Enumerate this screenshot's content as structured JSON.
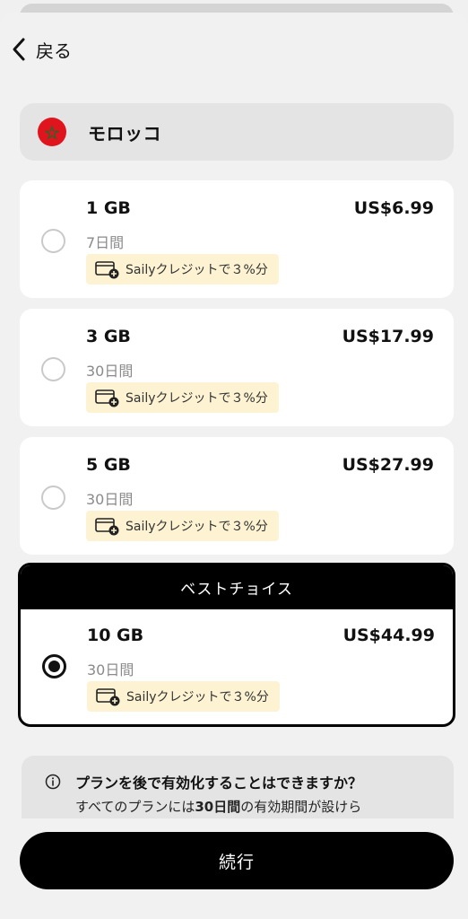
{
  "header": {
    "back_label": "戻る"
  },
  "country": {
    "name": "モロッコ",
    "flag_color": "#e0141c"
  },
  "plans": [
    {
      "size": "1 GB",
      "price": "US$6.99",
      "duration": "7日間",
      "credit": "Sailyクレジットで３%分",
      "selected": false
    },
    {
      "size": "3 GB",
      "price": "US$17.99",
      "duration": "30日間",
      "credit": "Sailyクレジットで３%分",
      "selected": false
    },
    {
      "size": "5 GB",
      "price": "US$27.99",
      "duration": "30日間",
      "credit": "Sailyクレジットで３%分",
      "selected": false
    },
    {
      "size": "10 GB",
      "price": "US$44.99",
      "duration": "30日間",
      "credit": "Sailyクレジットで３%分",
      "selected": true
    }
  ],
  "best_choice": {
    "label": "ベストチョイス"
  },
  "faq": {
    "question": "プランを後で有効化することはできますか？",
    "answer_prefix": "すべてのプランには",
    "answer_bold": "30日間",
    "answer_suffix": "の有効期間が設けら"
  },
  "footer": {
    "continue_label": "続行"
  },
  "colors": {
    "accent": "#000000",
    "credit_bg": "#fdf3d2",
    "card_bg": "#ffffff",
    "page_bg": "#f1f1f1"
  }
}
